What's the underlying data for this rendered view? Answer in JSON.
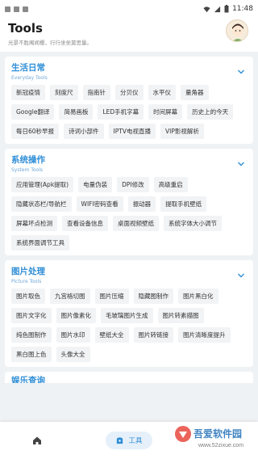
{
  "status_bar": {
    "time": "11:48"
  },
  "header": {
    "title": "Tools",
    "subtitle": "光景不胜阁闻樱，行行坐坐莫思量。"
  },
  "sections": [
    {
      "title": "生活日常",
      "subtitle": "Everyday Tools",
      "items": [
        "新冠疫情",
        "刻度尺",
        "指南针",
        "分贝仪",
        "水平仪",
        "量角器",
        "Google翻译",
        "简易画板",
        "LED手机字幕",
        "时间屏幕",
        "历史上的今天",
        "每日60秒早报",
        "诗词小部件",
        "IPTV电视直播",
        "VIP影视解析"
      ]
    },
    {
      "title": "系统操作",
      "subtitle": "System Tools",
      "items": [
        "应用管理(Apk提取)",
        "电量伪装",
        "DPI修改",
        "高级重启",
        "隐藏状态栏/导航栏",
        "WIFI密码查看",
        "振动器",
        "提取手机壁纸",
        "屏幕坏点检测",
        "查看设备信息",
        "桌面视频壁纸",
        "系统字体大小调节",
        "系统界面调节工具"
      ]
    },
    {
      "title": "图片处理",
      "subtitle": "Picture Tools",
      "items": [
        "图片取色",
        "九宫格切图",
        "图片压缩",
        "隐藏图制作",
        "图片黑白化",
        "图片文字化",
        "图片像素化",
        "毛玻璃图片生成",
        "图片转素描图",
        "纯色图制作",
        "图片水印",
        "壁纸大全",
        "图片转链接",
        "图片清晰度提升",
        "黑白图上色",
        "头像大全"
      ]
    }
  ],
  "partial_section": {
    "title": "娱乐查询"
  },
  "bottom_nav": {
    "tools_label": "工具"
  },
  "watermark": {
    "main": "吾爱软件园",
    "url": "www.52zixue.com"
  },
  "colors": {
    "accent": "#2f8ed6",
    "background": "#eef2f5",
    "chip": "#f1f3f5"
  },
  "icons": [
    "home-icon",
    "tools-icon",
    "chevron-down-icon",
    "wifi-icon",
    "battery-icon"
  ]
}
